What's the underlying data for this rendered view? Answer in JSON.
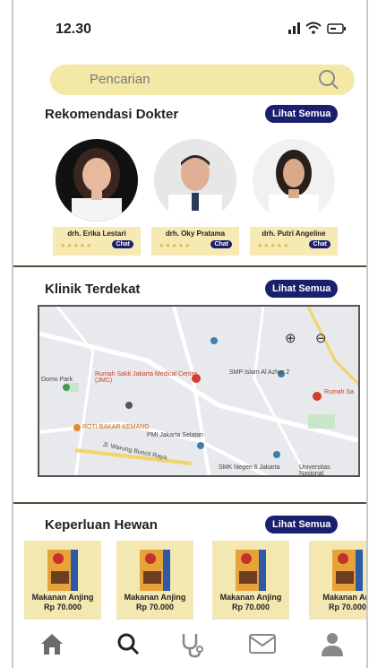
{
  "status_bar": {
    "time": "12.30"
  },
  "search": {
    "placeholder": "Pencarian"
  },
  "doctors_section": {
    "title": "Rekomendasi Dokter",
    "see_all": "Lihat Semua",
    "doctors": [
      {
        "name": "drh. Erika Lestari",
        "stars": "★★★★★",
        "chat": "Chat"
      },
      {
        "name": "drh. Oky Pratama",
        "stars": "★★★★★",
        "chat": "Chat"
      },
      {
        "name": "drh. Putri Angeline",
        "stars": "★★★★★",
        "chat": "Chat"
      }
    ]
  },
  "clinic_section": {
    "title": "Klinik Terdekat",
    "see_all": "Lihat Semua",
    "map_labels": {
      "hospital": "Rumah Sakit Jakarta Medical Center (JMC)",
      "school": "SMP Islam Al Azhar 2",
      "pmi": "PMI Jakarta Selatan",
      "bakery": "ROTI BAKAR KEMANG",
      "smk": "SMK Negeri 6 Jakarta",
      "road": "Jl. Warung Buncit Raya",
      "park": "Domo Park",
      "rs_right": "Rumah Sa",
      "univ": "Universitas Nasional"
    }
  },
  "pets_section": {
    "title": "Keperluan Hewan",
    "see_all": "Lihat Semua",
    "products": [
      {
        "name": "Makanan Anjing",
        "price": "Rp 70.000"
      },
      {
        "name": "Makanan Anjing",
        "price": "Rp 70.000"
      },
      {
        "name": "Makanan Anjing",
        "price": "Rp 70.000"
      },
      {
        "name": "Makanan Anj",
        "price": "Rp 70.000"
      }
    ]
  },
  "bottom_nav": [
    "home-icon",
    "search-icon",
    "stethoscope-icon",
    "mail-icon",
    "profile-icon"
  ]
}
